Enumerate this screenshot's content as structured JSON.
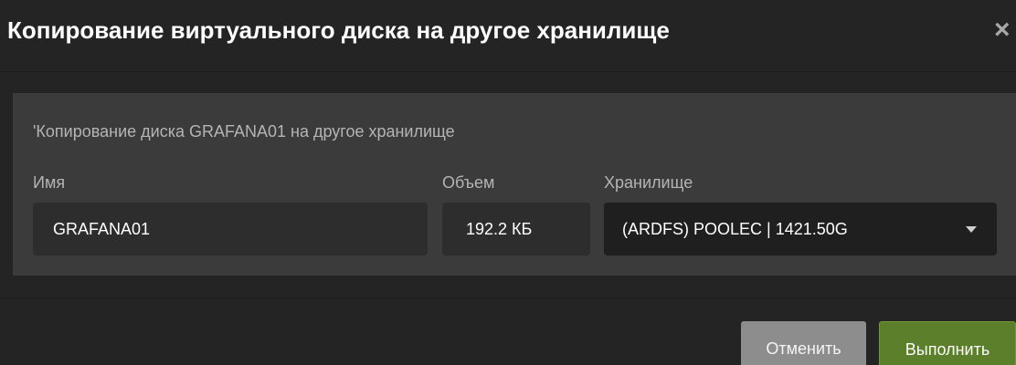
{
  "dialog": {
    "title": "Копирование виртуального диска на другое хранилище",
    "close_icon": "×"
  },
  "form": {
    "subtitle": "'Копирование диска GRAFANA01 на другое хранилище",
    "name": {
      "label": "Имя",
      "value": "GRAFANA01"
    },
    "size": {
      "label": "Объем",
      "value": "192.2 КБ"
    },
    "storage": {
      "label": "Хранилище",
      "selected": "(ARDFS) POOLEC | 1421.50G"
    }
  },
  "buttons": {
    "cancel": "Отменить",
    "execute": "Выполнить"
  },
  "colors": {
    "background": "#242424",
    "panel": "#3b3b3b",
    "execute_button": "#5b7f2b",
    "cancel_button": "#8d8d8d"
  }
}
